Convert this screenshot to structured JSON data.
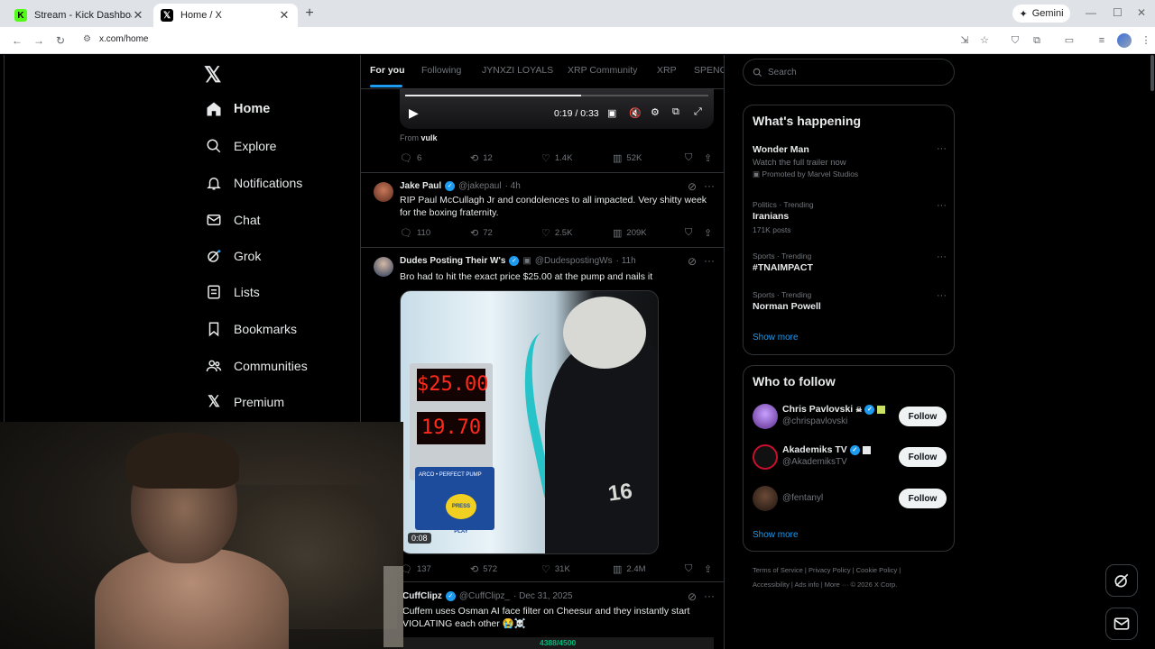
{
  "browser": {
    "tabs": [
      {
        "title": "Stream - Kick Dashboard",
        "favicon": "kick-logo"
      },
      {
        "title": "Home / X",
        "favicon": "x-logo"
      }
    ],
    "gemini_label": "Gemini",
    "url": "x.com/home"
  },
  "sidebar": {
    "logo": "𝕏",
    "items": [
      {
        "label": "Home",
        "icon": "home-icon"
      },
      {
        "label": "Explore",
        "icon": "search-icon"
      },
      {
        "label": "Notifications",
        "icon": "bell-icon"
      },
      {
        "label": "Chat",
        "icon": "mail-icon"
      },
      {
        "label": "Grok",
        "icon": "grok-icon"
      },
      {
        "label": "Lists",
        "icon": "list-icon"
      },
      {
        "label": "Bookmarks",
        "icon": "bookmark-icon"
      },
      {
        "label": "Communities",
        "icon": "people-icon"
      },
      {
        "label": "Premium",
        "icon": "x-icon"
      }
    ]
  },
  "feed": {
    "tabs": [
      "For you",
      "Following",
      "JYNXZI LOYALS",
      "XRP Community",
      "XRP",
      "SPENG"
    ],
    "video_player": {
      "time": "0:19 / 0:33",
      "progress": 0.58
    },
    "from_label": "From",
    "from_source": "vulk",
    "tweets": [
      {
        "actions": {
          "replies": "6",
          "reposts": "12",
          "likes": "1.4K",
          "views": "52K"
        }
      },
      {
        "name": "Jake Paul",
        "handle": "@jakepaul",
        "time": "· 4h",
        "text": "RIP Paul McCullagh Jr and condolences to all impacted. Very shitty week for the boxing fraternity.",
        "actions": {
          "replies": "110",
          "reposts": "72",
          "likes": "2.5K",
          "views": "209K"
        }
      },
      {
        "name": "Dudes Posting Their W's",
        "handle": "@DudespostingWs",
        "time": "· 11h",
        "text": "Bro had to hit the exact price $25.00 at the pump and nails it",
        "media": {
          "price_display": "25.00",
          "gallons_display": "19.70",
          "panel_label": "ARCO • PERFECT PUMP",
          "button_label": "PRESS PLAY",
          "jersey": "16",
          "duration": "0:08"
        },
        "actions": {
          "replies": "137",
          "reposts": "572",
          "likes": "31K",
          "views": "2.4M"
        }
      },
      {
        "name": "CuffClipz",
        "handle": "@CuffClipz_",
        "time": "· Dec 31, 2025",
        "text": "Cuffem uses Osman AI face filter on Cheesur and they instantly start VIOLATING each other 😭☠️",
        "thumb_counter": "4388/4500"
      }
    ]
  },
  "right": {
    "search_placeholder": "Search",
    "whats_happening": {
      "title": "What's happening",
      "trends": [
        {
          "meta": "",
          "name": "Wonder Man",
          "sub": "Watch the full trailer now",
          "promo": "Promoted by Marvel Studios"
        },
        {
          "meta": "Politics · Trending",
          "name": "Iranians",
          "sub": "171K posts",
          "promo": ""
        },
        {
          "meta": "Sports · Trending",
          "name": "#TNAIMPACT",
          "sub": "",
          "promo": ""
        },
        {
          "meta": "Sports · Trending",
          "name": "Norman Powell",
          "sub": "",
          "promo": ""
        }
      ],
      "show_more": "Show more"
    },
    "who_to_follow": {
      "title": "Who to follow",
      "accounts": [
        {
          "name": "Chris Pavlovski",
          "handle": "@chrispavlovski",
          "button": "Follow"
        },
        {
          "name": "Akademiks TV",
          "handle": "@AkademiksTV",
          "button": "Follow"
        },
        {
          "name": "",
          "handle": "@fentanyl",
          "button": "Follow"
        }
      ],
      "show_more": "Show more"
    },
    "footer": {
      "line1": "Terms of Service  |  Privacy Policy  |  Cookie Policy  |",
      "line2": "Accessibility  |  Ads info  |  More ···  © 2026 X Corp."
    }
  },
  "colors": {
    "accent": "#1d9bf0",
    "background": "#000000",
    "border": "#2f3336",
    "muted": "#71767b",
    "text": "#e7e9ea"
  }
}
